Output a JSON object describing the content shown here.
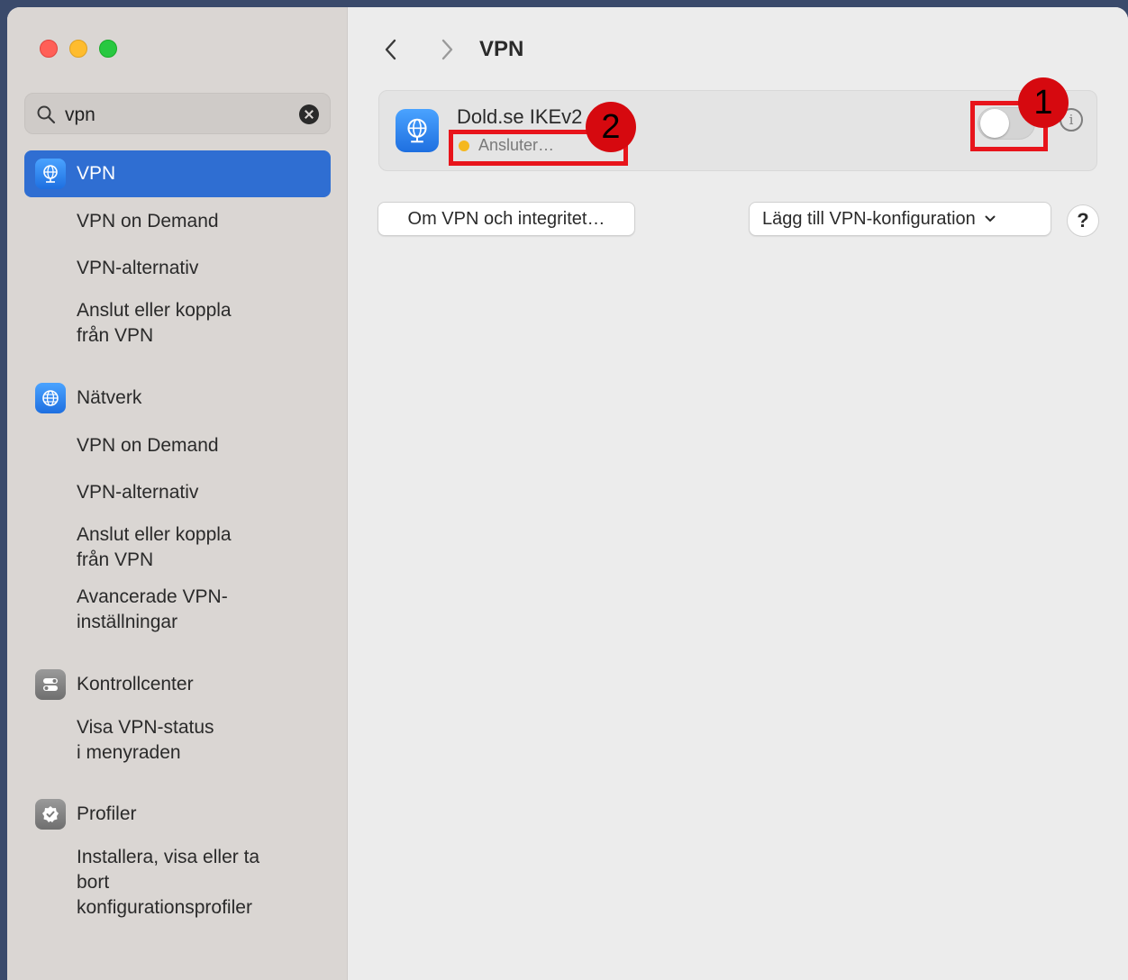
{
  "search": {
    "value": "vpn"
  },
  "sidebar": {
    "vpn": {
      "label": "VPN"
    },
    "vpn_items": [
      "VPN on Demand",
      "VPN-alternativ",
      "Anslut eller koppla\nfrån VPN"
    ],
    "network": {
      "label": "Nätverk"
    },
    "network_items": [
      "VPN on Demand",
      "VPN-alternativ",
      "Anslut eller koppla\nfrån VPN",
      "Avancerade VPN-\ninställningar"
    ],
    "control": {
      "label": "Kontrollcenter"
    },
    "control_items": [
      "Visa VPN-status\ni menyraden"
    ],
    "profiles": {
      "label": "Profiler"
    },
    "profiles_items": [
      "Installera, visa eller ta\nbort\nkonfigurationsprofiler"
    ]
  },
  "main": {
    "title": "VPN",
    "vpn_entry": {
      "name": "Dold.se IKEv2",
      "status": "Ansluter…",
      "enabled": false
    },
    "about_button": "Om VPN och integritet…",
    "add_button": "Lägg till VPN-konfiguration",
    "help_button": "?",
    "info_glyph": "i"
  },
  "annotations": {
    "badge1": "1",
    "badge2": "2"
  },
  "colors": {
    "accent": "#2f6ed2",
    "annotation_red": "#e8141b",
    "status_yellow": "#f5b81e"
  }
}
